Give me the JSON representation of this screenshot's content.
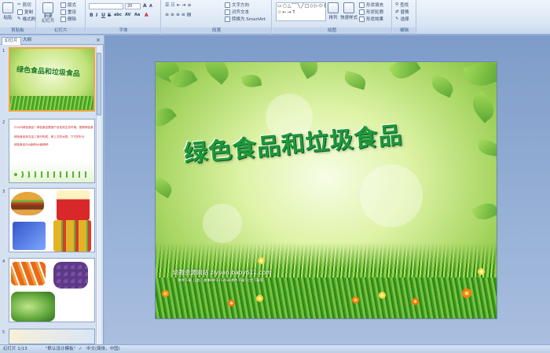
{
  "ribbon": {
    "clipboard": {
      "paste_label": "粘贴",
      "cut_label": "剪切",
      "copy_label": "复制",
      "format_painter_label": "格式刷",
      "group_label": "剪贴板"
    },
    "slides": {
      "new_slide_label": "新建\n幻灯片",
      "layout_label": "版式",
      "reset_label": "重设",
      "delete_label": "删除",
      "group_label": "幻灯片"
    },
    "font": {
      "font_size": "20",
      "bold": "B",
      "italic": "I",
      "underline": "U",
      "strikethrough": "S",
      "shadow": "abc",
      "spacing": "AV",
      "case": "Aa",
      "color": "A",
      "group_label": "字体"
    },
    "paragraph": {
      "text_direction_label": "文字方向",
      "align_text_label": "对齐文本",
      "smartart_label": "转换为 SmartArt",
      "group_label": "段落"
    },
    "drawing": {
      "shapes_glyphs": "▭○△⌒╲╱□◇▷⬭{}☆←→↑",
      "arrange_label": "排列",
      "quick_styles_label": "快速样式",
      "shape_fill_label": "形状填充",
      "shape_outline_label": "形状轮廓",
      "shape_effects_label": "形状效果",
      "group_label": "绘图"
    },
    "editing": {
      "find_label": "查找",
      "replace_label": "替换",
      "select_label": "选择",
      "group_label": "编辑"
    }
  },
  "left_pane": {
    "tab_slides": "幻灯片",
    "tab_outline": "大纲",
    "close_glyph": "×",
    "thumbnails": [
      {
        "number": "1",
        "title": "绿色食品和垃圾食品"
      },
      {
        "number": "2",
        "lines": [
          "什么叫绿色食品？绿色食品是指产自优良生态环境、按照绿色食品标准生产、实行全程质量控制",
          "绿色食品标志由三部分构成，即上方的太阳、下方的叶片",
          "绿色食品分A级和AA级两种"
        ]
      },
      {
        "number": "3"
      },
      {
        "number": "4"
      },
      {
        "number": "5"
      }
    ]
  },
  "slide": {
    "title": "绿色食品和垃圾食品",
    "site_name": "幼教资源网站  ziyuan.baby611.com",
    "site_desc": "课件下载    儿歌、故事MP3    FLASH课件下载    论文下载等"
  },
  "statusbar": {
    "slide_count": "幻灯片 1/13",
    "theme": "\"默认设计模板\"",
    "language": "中文(简体，中国)"
  }
}
